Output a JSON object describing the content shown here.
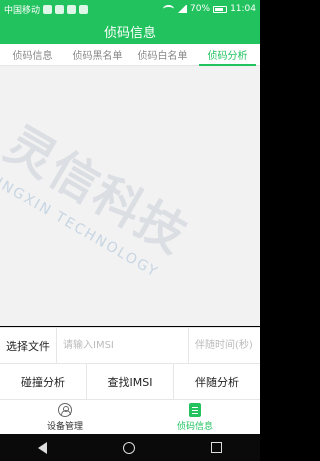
{
  "status_bar": {
    "carrier": "中国移动",
    "battery": "70%",
    "time": "11:04"
  },
  "title": "侦码信息",
  "tabs": [
    {
      "label": "侦码信息",
      "active": false
    },
    {
      "label": "侦码黑名单",
      "active": false
    },
    {
      "label": "侦码白名单",
      "active": false
    },
    {
      "label": "侦码分析",
      "active": true
    }
  ],
  "watermark": {
    "main": "灵信科技",
    "sub": "LINGXIN TECHNOLOGY"
  },
  "input_row": {
    "file_button": "选择文件",
    "imsi_placeholder": "请输入IMSI",
    "time_placeholder": "伴随时间(秒)"
  },
  "action_row": {
    "collision": "碰撞分析",
    "find_imsi": "查找IMSI",
    "follow": "伴随分析"
  },
  "bottom_nav": {
    "device": "设备管理",
    "info": "侦码信息"
  },
  "colors": {
    "accent": "#22c35e"
  }
}
